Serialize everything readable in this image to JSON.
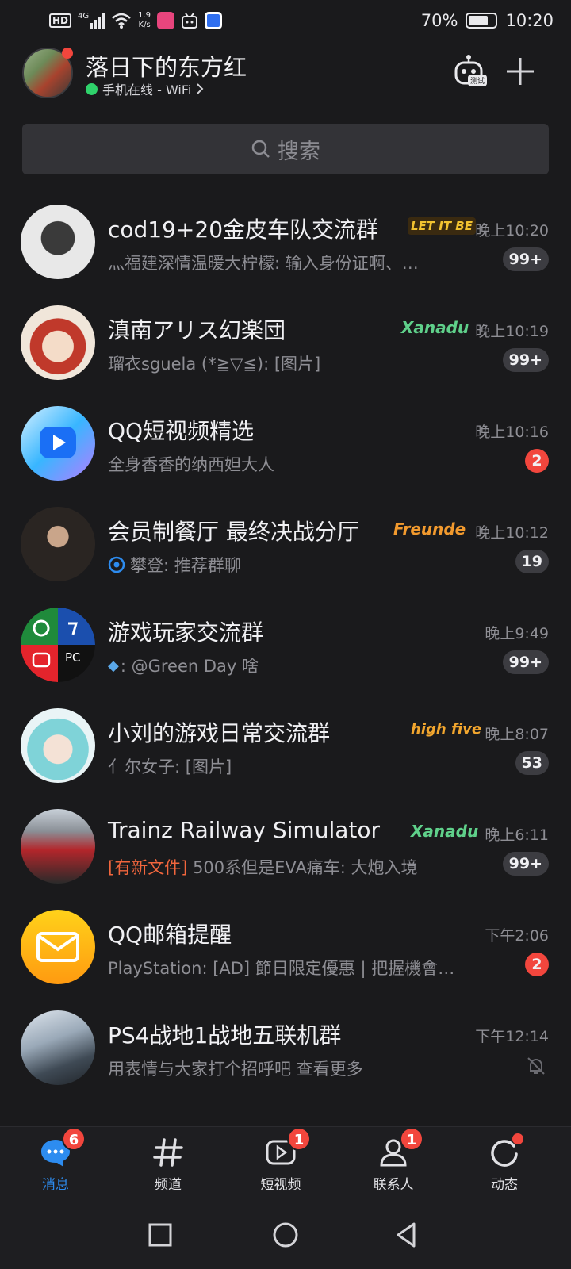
{
  "status_bar": {
    "hd": "HD",
    "network_type": "4G",
    "speed_value": "1.9",
    "speed_unit": "K/s",
    "battery": "70%",
    "time": "10:20"
  },
  "header": {
    "profile_name": "落日下的东方红",
    "online_status": "手机在线 - WiFi",
    "robot_tag": "测试"
  },
  "search": {
    "placeholder": "搜索"
  },
  "chats": [
    {
      "name": "cod19+20金皮车队交流群",
      "tag": "LET IT BE",
      "time": "晚上10:20",
      "preview": "灬福建深情温暖大柠檬: 输入身份证啊、…",
      "count": "99+"
    },
    {
      "name": "滇南アリス幻楽団",
      "tag": "Xanadu",
      "time": "晚上10:19",
      "preview": "瑠衣sguela (*≧▽≦): [图片]",
      "count": "99+"
    },
    {
      "name": "QQ短视频精选",
      "tag": "",
      "time": "晚上10:16",
      "preview": "全身香香的纳西妲大人",
      "count": "2"
    },
    {
      "name": "会员制餐厅  最终决战分厅",
      "tag": "Freunde",
      "time": "晚上10:12",
      "preview": "攀登: 推荐群聊",
      "count": "19"
    },
    {
      "name": "游戏玩家交流群",
      "tag": "",
      "time": "晚上9:49",
      "preview": ": @Green Day 啥",
      "count": "99+"
    },
    {
      "name": "小刘的游戏日常交流群",
      "tag": "high five",
      "time": "晚上8:07",
      "preview": "亻尔女子: [图片]",
      "count": "53"
    },
    {
      "name": "Trainz Railway Simulator",
      "tag": "Xanadu",
      "time": "晚上6:11",
      "preview_highlight": "[有新文件]",
      "preview": " 500系但是EVA痛车: 大炮入境",
      "count": "99+"
    },
    {
      "name": "QQ邮箱提醒",
      "tag": "",
      "time": "下午2:06",
      "preview": "PlayStation: [AD] 節日限定優惠 | 把握機會…",
      "count": "2"
    },
    {
      "name": "PS4战地1战地五联机群",
      "tag": "",
      "time": "下午12:14",
      "preview": "用表情与大家打个招呼吧 查看更多",
      "count": ""
    }
  ],
  "avatar_labels": {
    "console_pc": "PC"
  },
  "tabs": [
    {
      "label": "消息",
      "badge": "6"
    },
    {
      "label": "频道",
      "badge": ""
    },
    {
      "label": "短视频",
      "badge": "1"
    },
    {
      "label": "联系人",
      "badge": "1"
    },
    {
      "label": "动态",
      "badge": ""
    }
  ],
  "colors": {
    "accent": "#2d8cf0",
    "badge_red": "#f2463d",
    "online_green": "#2fd26b",
    "background": "#1a1a1c"
  }
}
